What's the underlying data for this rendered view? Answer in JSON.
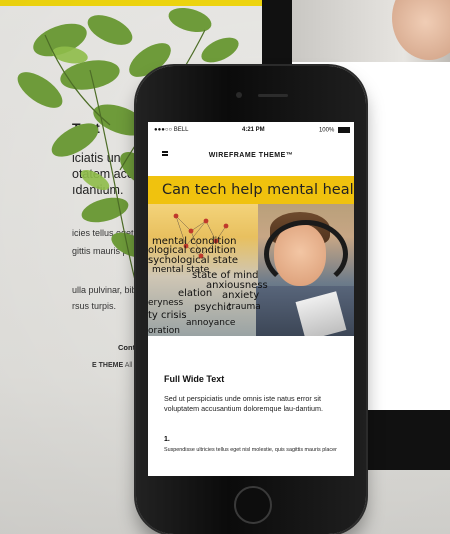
{
  "monitor": {
    "heading": "Text",
    "body_lines": [
      "iciatis unde o",
      "otatem accus",
      "ıdantium."
    ],
    "list_lines": [
      "icies tellus eget ni",
      "gittis mauris place"
    ],
    "list_lines2": [
      "ulla pulvinar, bibe",
      "rsus turpis."
    ],
    "contact": "Contact",
    "footer_brand": "E THEME",
    "footer_rights": "All Riht Reserve"
  },
  "phone": {
    "status": {
      "carrier": "●●●○○ BELL",
      "time": "4:21 PM",
      "battery": "100%"
    },
    "nav": {
      "brand": "WIREFRAME THEME™"
    },
    "hero": {
      "title": "Can tech help mental health?",
      "words": [
        "mental condition",
        "ological condition",
        "sychological state",
        "mental state",
        "state of mind",
        "anxiousness",
        "elation",
        "anxiety",
        "eryness",
        "psychic",
        "trauma",
        "ty crisis",
        "annoyance",
        "oration"
      ]
    },
    "content": {
      "title": "Full Wide Text",
      "body": "Sed ut perspiciatis unde omnis iste natus error sit voluptatem accusantium doloremque lau-dantium.",
      "list_number": "1.",
      "list_text": "Suspendisse ultricies tellus eget nisl molestie, quis sagittis mauris placer"
    }
  },
  "colors": {
    "accent": "#f3d90f",
    "phone_body": "#111111",
    "hero_banner": "#f0c20e"
  }
}
